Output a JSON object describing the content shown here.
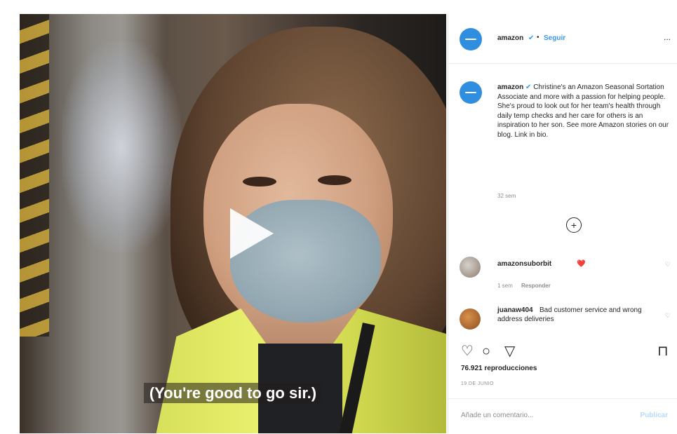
{
  "video": {
    "caption": "(You're good to go sir.)"
  },
  "post": {
    "username": "amazon",
    "follow_label": "Seguir",
    "more_label": "...",
    "caption_username": "amazon",
    "caption_text": "Christine's an Amazon Seasonal Sortation Associate and more with a passion for helping people. She's proud to look out for her team's health through daily temp checks and her care for others is an inspiration to her son. See more Amazon stories on our blog. Link in bio.",
    "caption_time": "32 sem",
    "comments": [
      {
        "username": "amazonsuborbit",
        "text": "❤️",
        "time": "1 sem",
        "reply_label": "Responder"
      },
      {
        "username": "juanaw404",
        "text": "Bad customer service and wrong address deliveries"
      }
    ],
    "views_label": "76.921 reproducciones",
    "date_label": "19 DE JUNIO",
    "comment_placeholder": "Añade un comentario...",
    "publish_label": "Publicar"
  },
  "icons": {
    "play": "play-icon",
    "like": "heart-icon",
    "comment": "comment-icon",
    "share": "share-icon",
    "save": "bookmark-icon",
    "load_more": "plus-circle-icon"
  },
  "colors": {
    "accent": "#3897f0",
    "avatar_blue": "#2f8ee0",
    "vest": "#dfe65e"
  }
}
